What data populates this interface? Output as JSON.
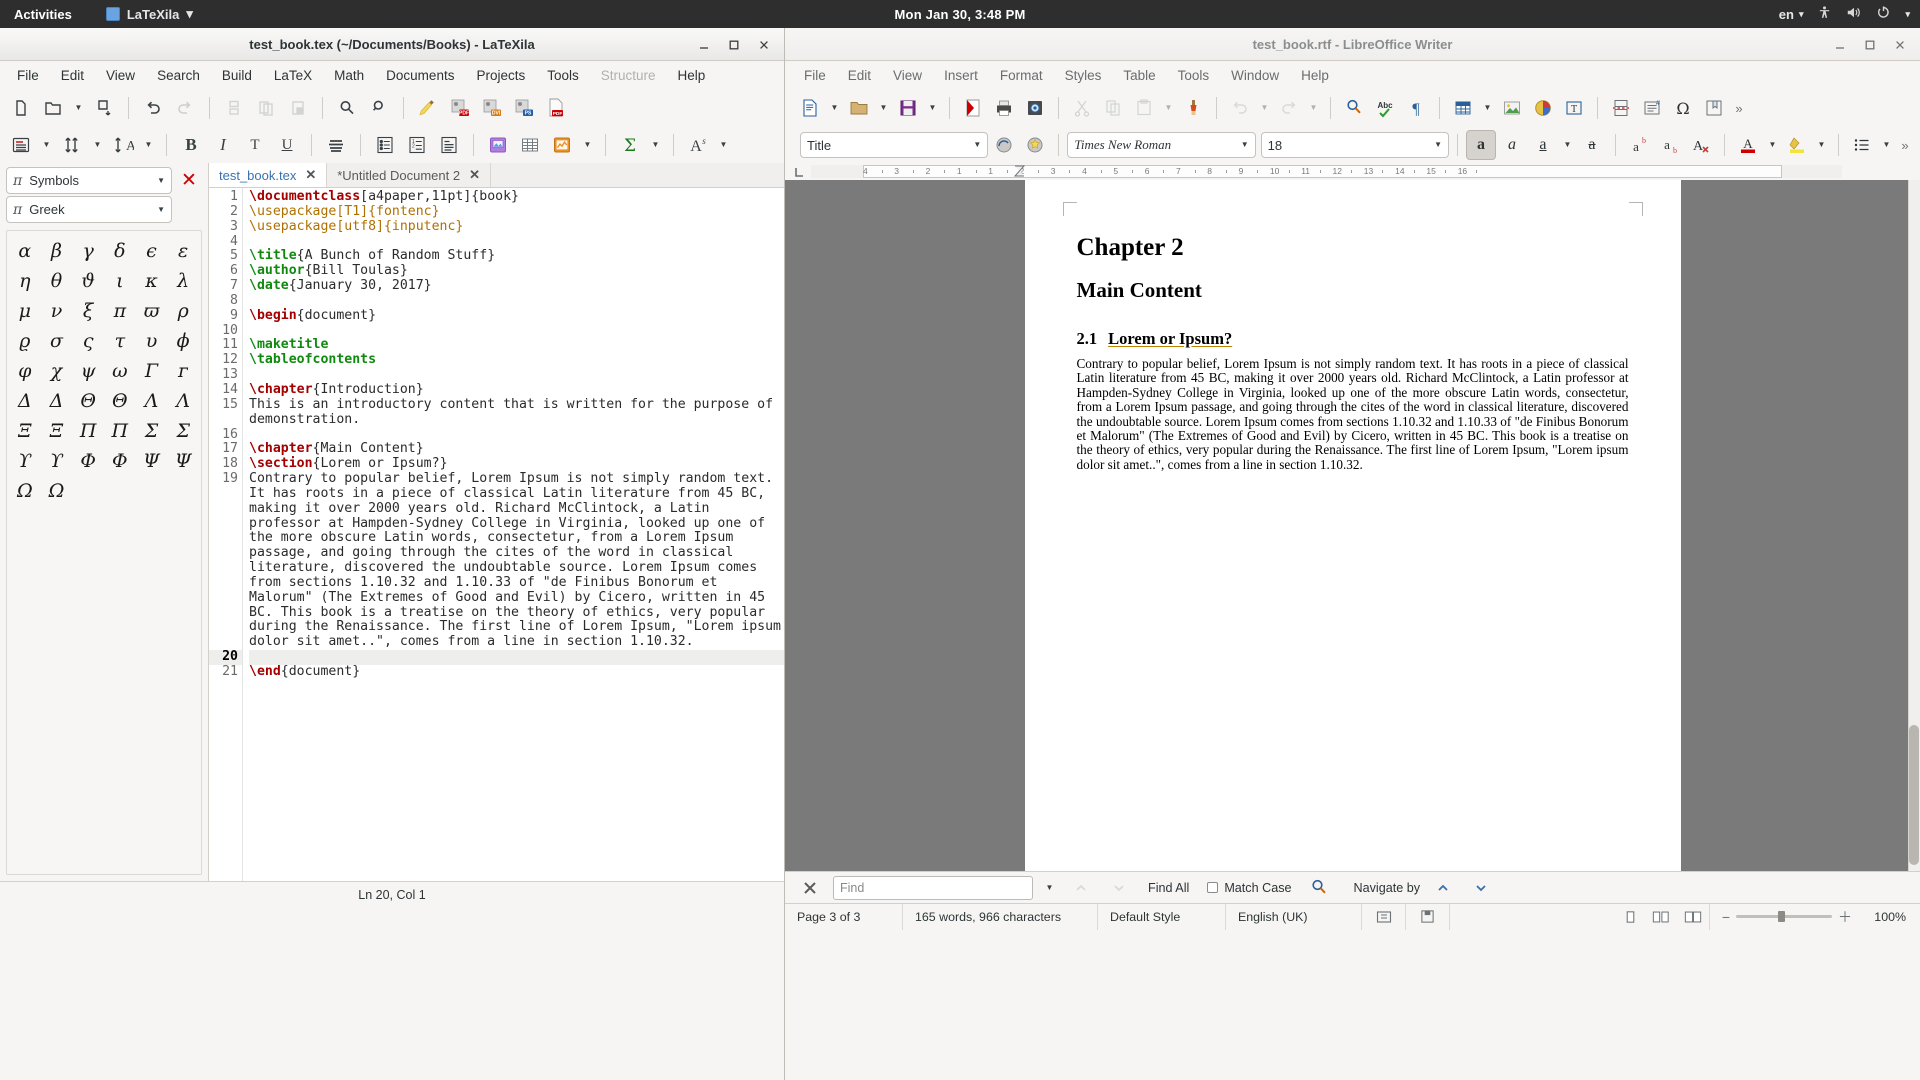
{
  "topbar": {
    "activities": "Activities",
    "app_name": "LaTeXila",
    "clock": "Mon Jan 30,  3:48 PM",
    "keyboard": "en",
    "icons": [
      "accessibility-icon",
      "volume-icon",
      "power-icon",
      "chevron-down-icon"
    ]
  },
  "latexila": {
    "title": "test_book.tex (~/Documents/Books) - LaTeXila",
    "menus": [
      "File",
      "Edit",
      "View",
      "Search",
      "Build",
      "LaTeX",
      "Math",
      "Documents",
      "Projects",
      "Tools",
      "Structure",
      "Help"
    ],
    "disabled_menus": [
      "Structure"
    ],
    "toolbar1": [
      "new-file-icon",
      "open-folder-icon",
      "open-dropdown-icon",
      "save-icon",
      "undo-icon",
      "redo-icon",
      "cut-icon",
      "copy-icon",
      "paste-icon",
      "find-icon",
      "find-replace-icon",
      "clean-build-files-icon",
      "build-pdf-icon",
      "build-dvi-icon",
      "build-ps-icon",
      "view-pdf-icon"
    ],
    "toolbar2": [
      "sectioning-icon",
      "sectioning-dropdown-icon",
      "size-icon",
      "size-dropdown-icon",
      "references-icon",
      "references-dropdown-icon",
      "bold-icon",
      "italic-icon",
      "typewriter-icon",
      "underline-icon",
      "text-style-icon",
      "itemize-icon",
      "enumerate-icon",
      "description-icon",
      "insert-figure-icon",
      "insert-table-icon",
      "insert-graph-icon",
      "graph-dropdown-icon",
      "math-sum-icon",
      "math-dropdown-icon",
      "math-font-icon",
      "font-dropdown-icon"
    ],
    "side_panel": {
      "close_label": "✕",
      "category": "Symbols",
      "group": "Greek",
      "symbols": [
        "α",
        "β",
        "γ",
        "δ",
        "ϵ",
        "ε",
        "η",
        "θ",
        "ϑ",
        "ι",
        "κ",
        "λ",
        "μ",
        "ν",
        "ξ",
        "π",
        "ϖ",
        "ρ",
        "ϱ",
        "σ",
        "ς",
        "τ",
        "υ",
        "ϕ",
        "φ",
        "χ",
        "ψ",
        "ω",
        "Γ",
        "ᴦ",
        "Δ",
        "Δ",
        "Θ",
        "Θ",
        "Λ",
        "Λ",
        "Ξ",
        "Ξ",
        "Π",
        "Π",
        "Σ",
        "Σ",
        "ϒ",
        "ϒ",
        "Φ",
        "Φ",
        "Ψ",
        "Ψ",
        "Ω",
        "Ω"
      ]
    },
    "tabs": [
      {
        "label": "test_book.tex",
        "active": true,
        "close": "✕"
      },
      {
        "label": "*Untitled Document 2",
        "active": false,
        "close": "✕"
      }
    ],
    "status": "Ln 20, Col 1",
    "code_lines": [
      {
        "n": 1,
        "parts": [
          {
            "t": "\\documentclass",
            "c": "k-red"
          },
          {
            "t": "[a4paper,11pt]{book}",
            "c": "k-txt"
          }
        ]
      },
      {
        "n": 2,
        "parts": [
          {
            "t": "\\usepackage",
            "c": "k-org"
          },
          {
            "t": "[T1]{fontenc}",
            "c": "k-org"
          }
        ]
      },
      {
        "n": 3,
        "parts": [
          {
            "t": "\\usepackage",
            "c": "k-org"
          },
          {
            "t": "[utf8]{inputenc}",
            "c": "k-org"
          }
        ]
      },
      {
        "n": 4,
        "parts": []
      },
      {
        "n": 5,
        "parts": [
          {
            "t": "\\title",
            "c": "k-grn"
          },
          {
            "t": "{A Bunch of Random Stuff}",
            "c": "k-txt"
          }
        ]
      },
      {
        "n": 6,
        "parts": [
          {
            "t": "\\author",
            "c": "k-grn"
          },
          {
            "t": "{Bill Toulas}",
            "c": "k-txt"
          }
        ]
      },
      {
        "n": 7,
        "parts": [
          {
            "t": "\\date",
            "c": "k-grn"
          },
          {
            "t": "{January 30, 2017}",
            "c": "k-txt"
          }
        ]
      },
      {
        "n": 8,
        "parts": []
      },
      {
        "n": 9,
        "parts": [
          {
            "t": "\\begin",
            "c": "k-red"
          },
          {
            "t": "{document}",
            "c": "k-txt"
          }
        ]
      },
      {
        "n": 10,
        "parts": []
      },
      {
        "n": 11,
        "parts": [
          {
            "t": "\\maketitle",
            "c": "k-grn"
          }
        ]
      },
      {
        "n": 12,
        "parts": [
          {
            "t": "\\tableofcontents",
            "c": "k-grn"
          }
        ]
      },
      {
        "n": 13,
        "parts": []
      },
      {
        "n": 14,
        "parts": [
          {
            "t": "\\chapter",
            "c": "k-red"
          },
          {
            "t": "{Introduction}",
            "c": "k-txt"
          }
        ]
      },
      {
        "n": 15,
        "parts": [
          {
            "t": "This is an introductory content that is written for the purpose of demonstration.",
            "c": "k-txt"
          }
        ]
      },
      {
        "n": 16,
        "parts": []
      },
      {
        "n": 17,
        "parts": [
          {
            "t": "\\chapter",
            "c": "k-red"
          },
          {
            "t": "{Main Content}",
            "c": "k-txt"
          }
        ]
      },
      {
        "n": 18,
        "parts": [
          {
            "t": "\\section",
            "c": "k-red"
          },
          {
            "t": "{Lorem or Ipsum?}",
            "c": "k-txt"
          }
        ]
      },
      {
        "n": 19,
        "parts": [
          {
            "t": "Contrary to popular belief, Lorem Ipsum is not simply random text. It has roots in a piece of classical Latin literature from 45 BC, making it over 2000 years old. Richard McClintock, a Latin professor at Hampden-Sydney College in Virginia, looked up one of the more obscure Latin words, consectetur, from a Lorem Ipsum passage, and going through the cites of the word in classical literature, discovered the undoubtable source. Lorem Ipsum comes from sections 1.10.32 and 1.10.33 of \"de Finibus Bonorum et Malorum\" (The Extremes of Good and Evil) by Cicero, written in 45 BC. This book is a treatise on the theory of ethics, very popular during the Renaissance. The first line of Lorem Ipsum, \"Lorem ipsum dolor sit amet..\", comes from a line in section 1.10.32.",
            "c": "k-txt"
          }
        ]
      },
      {
        "n": 20,
        "parts": [],
        "current": true
      },
      {
        "n": 21,
        "parts": [
          {
            "t": "\\end",
            "c": "k-red"
          },
          {
            "t": "{document}",
            "c": "k-txt"
          }
        ]
      }
    ]
  },
  "writer": {
    "title": "test_book.rtf - LibreOffice Writer",
    "menus": [
      "File",
      "Edit",
      "View",
      "Insert",
      "Format",
      "Styles",
      "Table",
      "Tools",
      "Window",
      "Help"
    ],
    "toolbar": [
      "new-document-icon",
      "new-dropdown-icon",
      "open-icon",
      "open-dropdown-icon",
      "save-icon",
      "save-dropdown-icon",
      "export-pdf-icon",
      "print-icon",
      "print-preview-icon",
      "cut-icon",
      "copy-icon",
      "paste-icon",
      "paste-dropdown-icon",
      "clone-formatting-icon",
      "undo-icon",
      "undo-dropdown-icon",
      "redo-icon",
      "redo-dropdown-icon",
      "find-replace-icon",
      "spelling-icon",
      "formatting-marks-icon",
      "insert-table-icon",
      "insert-table-dropdown-icon",
      "insert-image-icon",
      "insert-chart-icon",
      "insert-text-box-icon",
      "insert-page-break-icon",
      "insert-field-icon",
      "insert-special-character-icon",
      "insert-bookmark-icon",
      "overflow-icon"
    ],
    "paragraph_style": "Title",
    "font_name": "Times New Roman",
    "font_size": "18",
    "format_icons": [
      "update-style-icon",
      "new-style-icon",
      "bold-icon",
      "italic-icon",
      "underline-icon",
      "strikethrough-icon",
      "superscript-icon",
      "subscript-icon",
      "clear-formatting-icon",
      "font-color-icon",
      "font-color-dropdown-icon",
      "highlight-color-icon",
      "highlight-dropdown-icon",
      "unordered-list-icon",
      "list-dropdown-icon",
      "overflow-icon"
    ],
    "ruler_ticks": [
      "4",
      "3",
      "2",
      "1",
      "1",
      "2",
      "3",
      "4",
      "5",
      "6",
      "7",
      "8",
      "9",
      "10",
      "11",
      "12",
      "13",
      "14",
      "15",
      "16"
    ],
    "document": {
      "chapter_heading": "Chapter 2",
      "chapter_title": "Main Content",
      "section_number": "2.1",
      "section_title": "Lorem or Ipsum?",
      "body": "Contrary to popular belief, Lorem Ipsum is not simply random text. It has roots in a piece of classical Latin literature from 45 BC, making it over 2000 years old. Richard McClintock, a Latin professor at Hampden-Sydney College in Virginia, looked up one of the more obscure Latin words, consectetur, from a Lorem Ipsum passage, and going through the cites of the word in classical literature, discovered the undoubtable source. Lorem Ipsum comes from sections 1.10.32 and 1.10.33 of \"de Finibus Bonorum et Malorum\" (The Extremes of Good and Evil) by Cicero, written in 45 BC. This book is a treatise on the theory of ethics, very popular during the Renaissance. The first line of Lorem Ipsum, \"Lorem ipsum dolor sit amet..\", comes from a line in section 1.10.32."
    },
    "findbar": {
      "close": "✕",
      "placeholder": "Find",
      "find_all": "Find All",
      "match_case": "Match Case",
      "navigate_by": "Navigate by",
      "icons": [
        "close-icon",
        "find-dropdown-icon",
        "find-previous-icon",
        "find-next-icon",
        "find-toolbar-icon",
        "navigate-previous-icon",
        "navigate-next-icon"
      ]
    },
    "status": {
      "page": "Page 3 of 3",
      "word_count": "165 words, 966 characters",
      "page_style": "Default Style",
      "language": "English (UK)",
      "zoom": "100%",
      "icons": [
        "selection-mode-icon",
        "save-status-icon",
        "single-page-view-icon",
        "multi-page-view-icon",
        "book-view-icon",
        "zoom-out-icon",
        "zoom-in-icon"
      ]
    }
  }
}
